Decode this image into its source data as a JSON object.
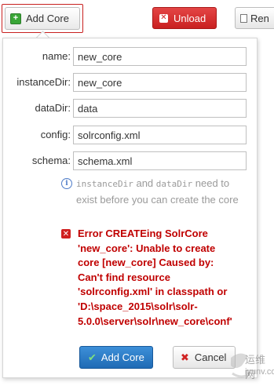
{
  "toolbar": {
    "add_core": "Add Core",
    "unload": "Unload",
    "rename": "Ren"
  },
  "dialog": {
    "fields": [
      {
        "label": "name:",
        "value": "new_core"
      },
      {
        "label": "instanceDir:",
        "value": "new_core"
      },
      {
        "label": "dataDir:",
        "value": "data"
      },
      {
        "label": "config:",
        "value": "solrconfig.xml"
      },
      {
        "label": "schema:",
        "value": "schema.xml"
      }
    ],
    "info": {
      "code1": "instanceDir",
      "and": " and ",
      "code2": "dataDir",
      "rest": " need to exist before you can create the core"
    },
    "error": "Error CREATEing SolrCore\n'new_core': Unable to create\ncore [new_core] Caused by:\nCan't find resource\n'solrconfig.xml' in classpath or\n'D:\\space_2015\\solr\\solr-\n5.0.0\\server\\solr\\new_core\\conf'",
    "submit": "Add Core",
    "cancel": "Cancel"
  },
  "watermark": {
    "cn": "运维网",
    "url": "iyunv.com"
  },
  "colors": {
    "danger": "#c92020",
    "primary": "#1f6bb5",
    "error_text": "#c00000"
  }
}
